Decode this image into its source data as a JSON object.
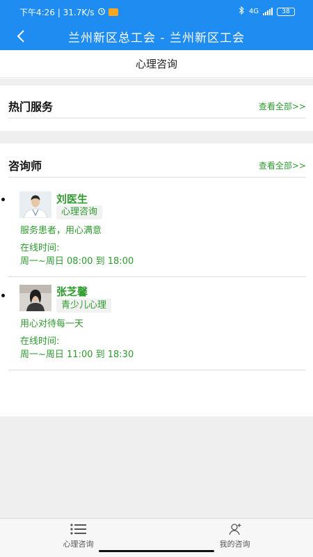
{
  "status_bar": {
    "time_speed": "下午4:26 | 31.7K/s",
    "network": "4G",
    "battery": "38"
  },
  "app_bar": {
    "title": "兰州新区总工会 - 兰州新区工会"
  },
  "page": {
    "title": "心理咨询"
  },
  "sections": {
    "hot_services": {
      "title": "热门服务",
      "more": "查看全部>>"
    },
    "counselors": {
      "title": "咨询师",
      "more": "查看全部>>"
    }
  },
  "counselors": [
    {
      "name": "刘医生",
      "tag": "心理咨询",
      "motto": "服务患者，用心满意",
      "online_label": "在线时间:",
      "hours": "周一~周日 08:00 到 18:00"
    },
    {
      "name": "张芝馨",
      "tag": "青少儿心理",
      "motto": "用心对待每一天",
      "online_label": "在线时间:",
      "hours": "周一~周日 11:00 到 18:30"
    }
  ],
  "tabbar": {
    "tab1": "心理咨询",
    "tab2": "我的咨询"
  },
  "colors": {
    "primary_blue": "#1e8cf0",
    "accent_green": "#2e9a2e"
  }
}
